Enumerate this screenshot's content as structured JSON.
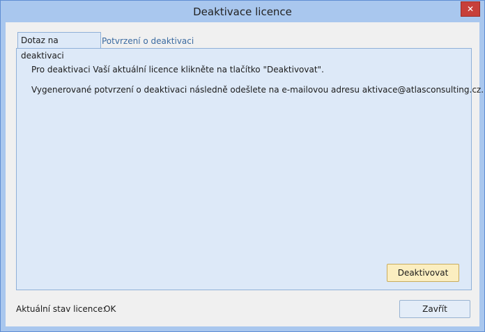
{
  "window": {
    "title": "Deaktivace licence",
    "close_glyph": "✕"
  },
  "tabs": [
    {
      "label": "Dotaz na deaktivaci",
      "active": true
    },
    {
      "label": "Potvrzení o deaktivaci",
      "active": false
    }
  ],
  "panel": {
    "instruction_line1": "Pro deaktivaci Vaší aktuální licence klikněte na tlačítko \"Deaktivovat\".",
    "instruction_line2": "Vygenerované potvrzení o deaktivaci následně odešlete na e-mailovou adresu aktivace@atlasconsulting.cz.",
    "deactivate_button": "Deaktivovat"
  },
  "footer": {
    "status_label": "Aktuální stav licence:",
    "status_value": "OK",
    "close_button": "Zavřít"
  },
  "colors": {
    "title_bar": "#a9c7ee",
    "panel_bg": "#dde9f8",
    "primary_button": "#fbeec0",
    "close_button": "#c7403a"
  }
}
